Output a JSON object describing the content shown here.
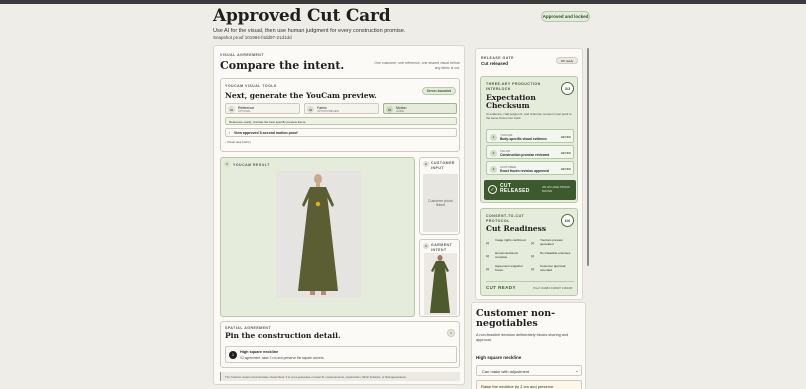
{
  "header": {
    "title": "Approved Cut Card",
    "subtitle": "Use AI for the visual, then use human judgment for every construction promise.",
    "snapshot": "Snapshot proof 101984-f4dd97-21d1dd",
    "status_badge": "Approved and locked"
  },
  "visual_agreement": {
    "label": "VISUAL AGREEMENT",
    "heading": "Compare the intent.",
    "note": "One customer, one reference, one shared visual before any fabric is cut.",
    "tools": {
      "label": "YOUCAM VISUAL TOOLS",
      "heading": "Next, generate the YouCam preview.",
      "badge": "Server-bounded",
      "options": [
        {
          "num": "01",
          "name": "Reference",
          "sub": "OPTIONAL"
        },
        {
          "num": "02",
          "name": "Fabric",
          "sub": "OPTION PREVIEW"
        },
        {
          "num": "03",
          "name": "Motion",
          "sub": "GUIDE"
        }
      ],
      "ready_text": "Reference ready: Uncrate the best specific preview frame.",
      "approved_link": "View approved 5-second motion proof",
      "guide_link": "Visual task history"
    },
    "result": {
      "num": "1",
      "label": "YOUCAM RESULT"
    },
    "customer_input": {
      "num": "2",
      "label": "CUSTOMER INPUT",
      "placeholder": "Customer photo linked"
    },
    "garment_intent": {
      "num": "3",
      "label": "GARMENT INTENT"
    }
  },
  "spatial_agreement": {
    "label": "SPATIAL AGREEMENT",
    "heading": "Pin the construction detail.",
    "badge": "1",
    "item": {
      "num": "1",
      "name": "High square neckline",
      "desc": "V2 agreement: raise 2 cm and preserve the square corners."
    },
    "footer_note": "The YouCam output communicates visual intent. It is not a guarantee of exact fit, measurements, construction, fabric behavior, or final appearance."
  },
  "release": {
    "label": "RELEASE GATE",
    "value": "Cut released",
    "badge": "3/6 ready"
  },
  "interlock": {
    "label": "THREE-KEY PRODUCTION INTERLOCK",
    "heading": "Expectation Checksum",
    "count": "3/3",
    "desc": "AI evidence, craft judgment, and customer consent must point to the same frozen Cut Card.",
    "keys": [
      {
        "num": "1",
        "role": "YOUCAM",
        "name": "Body-specific visual evidence",
        "status": "KEYED"
      },
      {
        "num": "2",
        "role": "TAILOR",
        "name": "Construction promise reviewed",
        "status": "KEYED"
      },
      {
        "num": "3",
        "role": "CUSTOMER",
        "name": "Exact frozen revision approved",
        "status": "KEYED"
      }
    ],
    "released_title": "CUT RELEASED",
    "released_note": "ON AN HASH PROOF BOUND"
  },
  "readiness": {
    "label": "CONSENT-TO-CUT PROTOCOL",
    "heading": "Cut Readiness",
    "count": "6/6",
    "items": [
      {
        "mark": "[x]",
        "text": "Image rights confirmed"
      },
      {
        "mark": "[x]",
        "text": "YouCam preview generated"
      },
      {
        "mark": "[x]",
        "text": "Human decisions complete"
      },
      {
        "mark": "[x]",
        "text": "No infeasible promises"
      },
      {
        "mark": "[x]",
        "text": "Agreement snapshot frozen"
      },
      {
        "mark": "[x]",
        "text": "Customer approval recorded"
      }
    ],
    "footer_status": "CUT READY",
    "footer_proof": "Proof 101984 F4DD97 21D1DD"
  },
  "negotiables": {
    "heading": "Customer non-negotiables",
    "desc": "A non-feasible decision deliberately blocks sharing and approval.",
    "item_title": "High square neckline",
    "select_value": "Can make with adjustment",
    "input_value": "Raise the neckline by 2 cm and preserve"
  },
  "colors": {
    "accent_green": "#4c6b3a",
    "dark_green": "#3d5a2e",
    "dress_green": "#5a5e32"
  }
}
